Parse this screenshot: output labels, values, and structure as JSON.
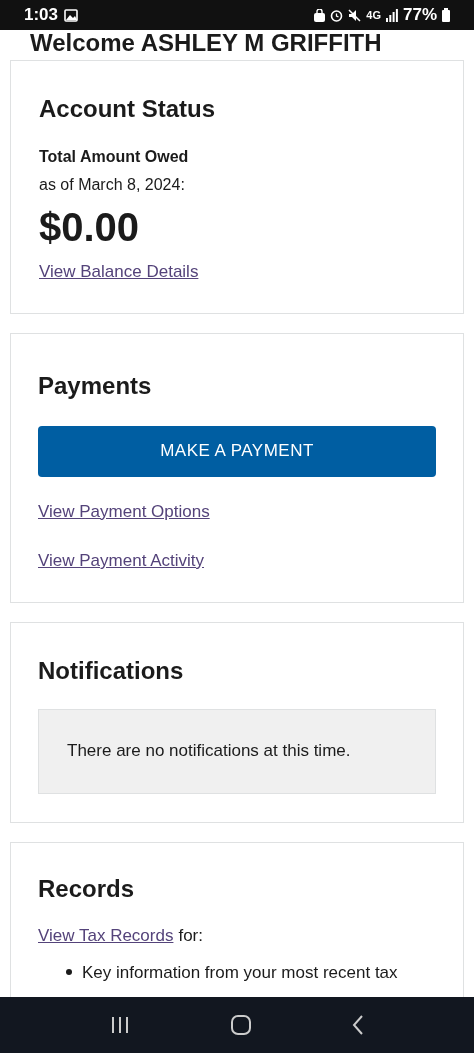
{
  "status_bar": {
    "time": "1:03",
    "network": "4G",
    "battery": "77%"
  },
  "welcome": "Welcome ASHLEY M GRIFFITH",
  "account_status": {
    "title": "Account Status",
    "label": "Total Amount Owed",
    "as_of": "as of March 8, 2024:",
    "amount": "$0.00",
    "link": "View Balance Details"
  },
  "payments": {
    "title": "Payments",
    "button": "MAKE A PAYMENT",
    "links": [
      "View Payment Options",
      "View Payment Activity"
    ]
  },
  "notifications": {
    "title": "Notifications",
    "message": "There are no notifications at this time."
  },
  "records": {
    "title": "Records",
    "link": "View Tax Records",
    "link_suffix": "for:",
    "bullets": [
      "Key information from your most recent tax"
    ]
  }
}
